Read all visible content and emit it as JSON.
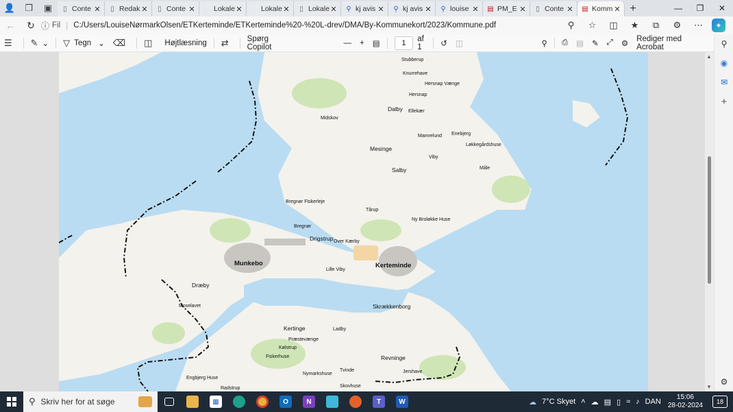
{
  "window": {
    "tabs": [
      {
        "label": "Conte",
        "icon": "doc-icon"
      },
      {
        "label": "Redak",
        "icon": "doc-icon"
      },
      {
        "label": "Conte",
        "icon": "doc-icon"
      },
      {
        "label": "Lokale",
        "icon": "blank-icon"
      },
      {
        "label": "Lokale",
        "icon": "blank-icon"
      },
      {
        "label": "Lokale",
        "icon": "doc-icon"
      },
      {
        "label": "kj avis",
        "icon": "search-icon"
      },
      {
        "label": "kj avis",
        "icon": "search-icon"
      },
      {
        "label": "louise",
        "icon": "search-icon"
      },
      {
        "label": "PM_E",
        "icon": "pdf-icon"
      },
      {
        "label": "Conte",
        "icon": "doc-icon"
      },
      {
        "label": "Komm",
        "icon": "pdf-icon",
        "active": true
      }
    ]
  },
  "address": {
    "scheme": "Fil",
    "url": "C:/Users/LouiseNørmarkOlsen/ETKerteminde/ETKerteminde%20-%20L-drev/DMA/By-Kommunekort/2023/Kommune.pdf"
  },
  "pdf_toolbar": {
    "draw": "Tegn",
    "read_aloud": "Højtlæsning",
    "ask_copilot": "Spørg Copilot",
    "page": "1",
    "page_of": "af 1",
    "edit_acrobat": "Rediger med Acrobat"
  },
  "map": {
    "colors": {
      "water": "#b9dcf2",
      "land": "#f4f2ec",
      "forest": "#cfe5b6",
      "urban": "#c9c6c2",
      "industrial": "#f3d6a4"
    },
    "towns": [
      {
        "name": "Stubberup",
        "size": "small"
      },
      {
        "name": "Knurrehave",
        "size": "small"
      },
      {
        "name": "Hersnap Vænge",
        "size": "small"
      },
      {
        "name": "Hersnap",
        "size": "small"
      },
      {
        "name": "Dalby",
        "size": "mid"
      },
      {
        "name": "Ellekær",
        "size": "small"
      },
      {
        "name": "Midskov",
        "size": "small"
      },
      {
        "name": "Enebjerg",
        "size": "small"
      },
      {
        "name": "Mamrelund",
        "size": "small"
      },
      {
        "name": "Løkkegårdshuse",
        "size": "small"
      },
      {
        "name": "Mesinge",
        "size": "mid"
      },
      {
        "name": "Viby",
        "size": "small"
      },
      {
        "name": "Salby",
        "size": "mid"
      },
      {
        "name": "Måle",
        "size": "small"
      },
      {
        "name": "Bregnør Fiskerleje",
        "size": "small"
      },
      {
        "name": "Tårup",
        "size": "small"
      },
      {
        "name": "Ny Broløkke Huse",
        "size": "small"
      },
      {
        "name": "Bregnør",
        "size": "small"
      },
      {
        "name": "Drigstrup",
        "size": "mid"
      },
      {
        "name": "Over Kærby",
        "size": "small"
      },
      {
        "name": "Munkebo",
        "size": "big"
      },
      {
        "name": "Kerteminde",
        "size": "big"
      },
      {
        "name": "Lille Viby",
        "size": "small"
      },
      {
        "name": "Dræby",
        "size": "mid"
      },
      {
        "name": "Moselavet",
        "size": "small"
      },
      {
        "name": "Skrækkenborg",
        "size": "mid"
      },
      {
        "name": "Kertinge",
        "size": "mid"
      },
      {
        "name": "Ladby",
        "size": "small"
      },
      {
        "name": "Præstevænge",
        "size": "small"
      },
      {
        "name": "Kølstrup",
        "size": "small"
      },
      {
        "name": "Fiskerhuse",
        "size": "small"
      },
      {
        "name": "Revninge",
        "size": "mid"
      },
      {
        "name": "Nymarkshuse",
        "size": "small"
      },
      {
        "name": "Tvinde",
        "size": "small"
      },
      {
        "name": "Jershave",
        "size": "small"
      },
      {
        "name": "Engbjerg Huse",
        "size": "small"
      },
      {
        "name": "Radstrup",
        "size": "small"
      },
      {
        "name": "Skovhuse",
        "size": "small"
      }
    ]
  },
  "taskbar": {
    "search_placeholder": "Skriv her for at søge",
    "weather": "7°C  Skyet",
    "language": "DAN",
    "time": "15:06",
    "date": "28-02-2024",
    "notifications": "18"
  }
}
